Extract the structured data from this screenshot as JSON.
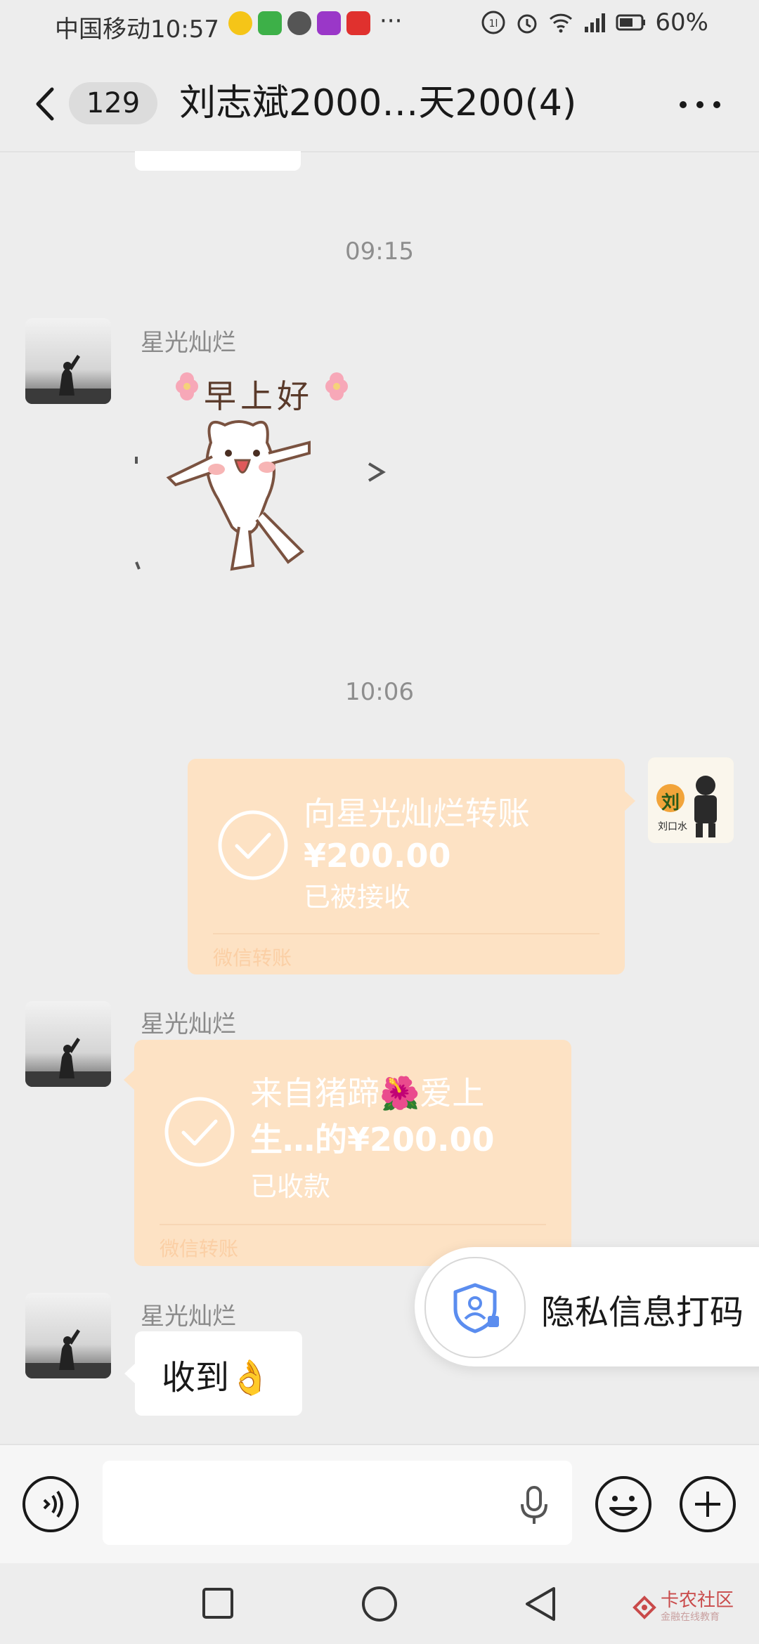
{
  "status_bar": {
    "carrier": "中国移动",
    "time": "10:57",
    "more": "···",
    "battery": "60%"
  },
  "header": {
    "unread_count": "129",
    "title": "刘志斌2000…天200(4)"
  },
  "messages": {
    "time_1": "09:15",
    "sticker_sender": "星光灿烂",
    "sticker_caption": "早上好",
    "time_2": "10:06",
    "outgoing_transfer": {
      "title": "向星光灿烂转账",
      "amount": "¥200.00",
      "status": "已被接收",
      "footer": "微信转账",
      "avatar_badge": "刘",
      "avatar_caption": "刘口水"
    },
    "incoming_transfer": {
      "sender": "星光灿烂",
      "title_line1": "来自猪蹄🌺爱上",
      "title_line2": "生…的¥200.00",
      "status": "已收款",
      "footer": "微信转账"
    },
    "reply": {
      "sender": "星光灿烂",
      "text": "收到👌"
    }
  },
  "privacy_button": {
    "label": "隐私信息打码"
  },
  "input_bar": {
    "placeholder": ""
  },
  "watermark": {
    "text": "卡农社区",
    "subtext": "金融在线教育"
  },
  "colors": {
    "background": "#ededed",
    "transfer_card": "#fde2c4",
    "privacy_icon": "#5b8def"
  },
  "icons": {
    "back": "chevron-left-icon",
    "more": "more-dots-icon",
    "voice": "voice-icon",
    "mic": "microphone-icon",
    "emoji": "emoji-icon",
    "plus": "plus-icon",
    "privacy": "shield-person-icon"
  }
}
